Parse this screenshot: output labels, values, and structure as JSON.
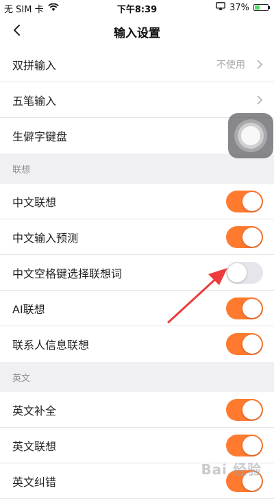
{
  "status_bar": {
    "carrier": "无 SIM 卡",
    "time": "下午8:39",
    "battery_percent": "37%",
    "battery_level": 0.37
  },
  "header": {
    "title": "输入设置"
  },
  "rows_top": [
    {
      "label": "双拼输入",
      "value": "不使用"
    },
    {
      "label": "五笔输入"
    },
    {
      "label": "生僻字键盘"
    }
  ],
  "section_association": {
    "header": "联想",
    "rows": [
      {
        "label": "中文联想",
        "on": true
      },
      {
        "label": "中文输入预测",
        "on": true
      },
      {
        "label": "中文空格键选择联想词",
        "on": false
      },
      {
        "label": "AI联想",
        "on": true
      },
      {
        "label": "联系人信息联想",
        "on": true
      }
    ]
  },
  "section_english": {
    "header": "英文",
    "rows": [
      {
        "label": "英文补全",
        "on": true
      },
      {
        "label": "英文联想",
        "on": true
      },
      {
        "label": "英文纠错",
        "on": true
      }
    ]
  },
  "watermark": "Bai 经验",
  "colors": {
    "toggle_on": "#ff7a2f",
    "toggle_off": "#e5e5ea",
    "annotation_arrow": "#ee3b3b",
    "battery_fill": "#4cd964"
  }
}
